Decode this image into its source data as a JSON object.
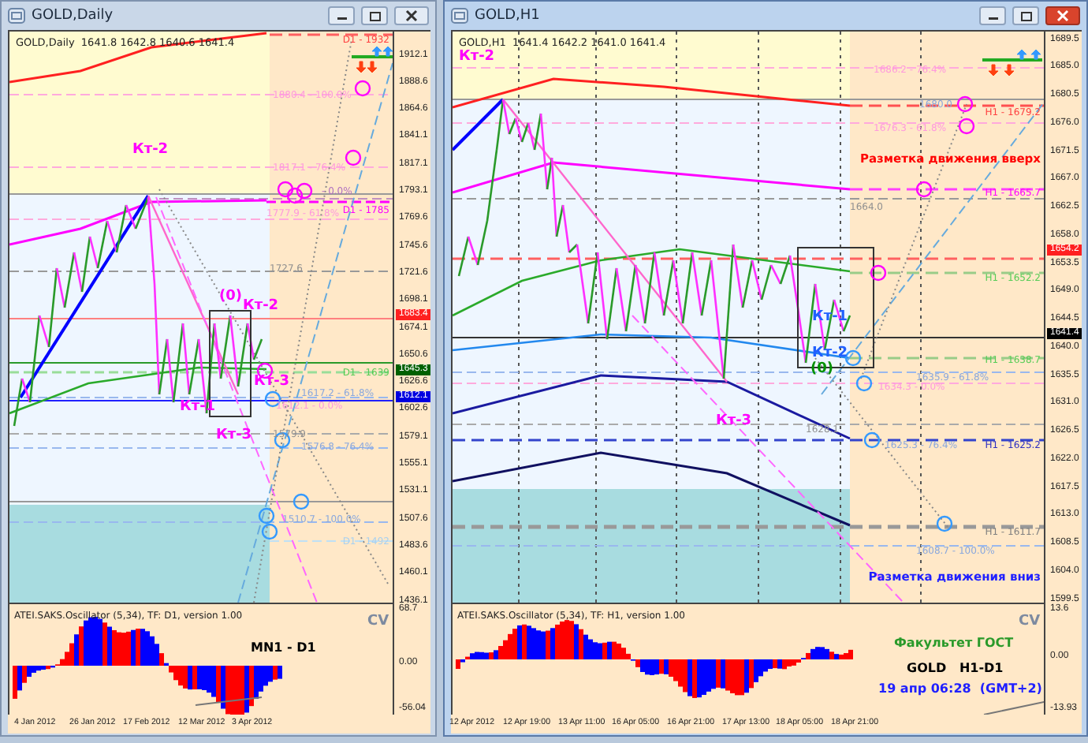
{
  "windows": [
    {
      "title": "GOLD,Daily",
      "active": false,
      "header": "GOLD,Daily  1641.8 1642.8 1640.6 1641.4",
      "labels": [
        {
          "text": "D1 - 1932",
          "kind": "level",
          "color": "#ff4040"
        },
        {
          "text": "1880.4 - 100.0%",
          "kind": "level",
          "color": "#ff99dd"
        },
        {
          "text": "Кт-2",
          "kind": "point",
          "color": "#ff00ff"
        },
        {
          "text": "1817.1 - 76.4%",
          "kind": "level",
          "color": "#ff99dd"
        },
        {
          "text": "- 0.0%",
          "kind": "level",
          "color": "#b070c0"
        },
        {
          "text": "D1 - 1785",
          "kind": "level",
          "color": "#ff00ff"
        },
        {
          "text": "1777.9 - 61.8%",
          "kind": "level",
          "color": "#ff99dd"
        },
        {
          "text": "1727.6",
          "kind": "level",
          "color": "#909090"
        },
        {
          "text": "(0)",
          "kind": "point",
          "color": "#ff00ff"
        },
        {
          "text": "Кт-2",
          "kind": "point",
          "color": "#ff00ff"
        },
        {
          "text": "D1 - 1639",
          "kind": "level",
          "color": "#55cc55"
        },
        {
          "text": "Кт-3",
          "kind": "point",
          "color": "#ff00ff"
        },
        {
          "text": "1617.2 - 61.8%",
          "kind": "level",
          "color": "#8aa8dd"
        },
        {
          "text": "Кт-1",
          "kind": "point",
          "color": "#ff00ff"
        },
        {
          "text": "1612.1 - 0.0%",
          "kind": "level",
          "color": "#ff99dd"
        },
        {
          "text": "Кт-3",
          "kind": "point",
          "color": "#ff00ff"
        },
        {
          "text": "1579.9",
          "kind": "level",
          "color": "#909090"
        },
        {
          "text": "1576.8 - 76.4%",
          "kind": "level",
          "color": "#8aa8dd"
        },
        {
          "text": "1510.7 - 100.0%",
          "kind": "level",
          "color": "#8aa8dd"
        },
        {
          "text": "D1 - 1492",
          "kind": "level",
          "color": "#a8d0f0"
        }
      ],
      "price_axis": [
        "1912.1",
        "1888.6",
        "1864.6",
        "1841.1",
        "1817.1",
        "1793.1",
        "1769.6",
        "1745.6",
        "1721.6",
        "1698.1",
        "1674.1",
        "1650.6",
        "1626.6",
        "1602.6",
        "1579.1",
        "1555.1",
        "1531.1",
        "1507.6",
        "1483.6",
        "1460.1",
        "1436.1"
      ],
      "price_markers": [
        {
          "text": "1683.4",
          "color": "#ff2020"
        },
        {
          "text": "1645.3",
          "color": "#006000"
        },
        {
          "text": "1612.1",
          "color": "#0000e0"
        }
      ],
      "oscillator": {
        "title": "ATEI.SAKS.Oscillator (5,34), TF: D1, version 1.00",
        "tag": "CV",
        "axis": [
          "68.7",
          "0.00",
          "-56.04"
        ],
        "notes": [
          {
            "text": "MN1 - D1",
            "color": "#000000"
          }
        ]
      },
      "time_axis": [
        "4 Jan 2012",
        "26 Jan 2012",
        "17 Feb 2012",
        "12 Mar 2012",
        "3 Apr 2012"
      ]
    },
    {
      "title": "GOLD,H1",
      "active": true,
      "header": "GOLD,H1  1641.4 1642.2 1641.0 1641.4",
      "labels": [
        {
          "text": "Кт-2",
          "kind": "point",
          "color": "#ff00ff"
        },
        {
          "text": "1686.2 - 76.4%",
          "kind": "level",
          "color": "#ff99dd"
        },
        {
          "text": "1680.0",
          "kind": "level",
          "color": "#8aa8dd"
        },
        {
          "text": "H1 - 1679.2",
          "kind": "level",
          "color": "#ff4040"
        },
        {
          "text": "1676.3 - 61.8%",
          "kind": "level",
          "color": "#ff99dd"
        },
        {
          "text": "Разметка движения вверх",
          "kind": "heading",
          "color": "#ff0000"
        },
        {
          "text": "H1 - 1665.7",
          "kind": "level",
          "color": "#ff00ff"
        },
        {
          "text": "1664.0",
          "kind": "level",
          "color": "#909090"
        },
        {
          "text": "H1 - 1652.2",
          "kind": "level",
          "color": "#55cc55"
        },
        {
          "text": "Кт-1",
          "kind": "point",
          "color": "#2060ff"
        },
        {
          "text": "Кт-2",
          "kind": "point",
          "color": "#2060ff"
        },
        {
          "text": "(0)",
          "kind": "point",
          "color": "#009000"
        },
        {
          "text": "H1 - 1638.7",
          "kind": "level",
          "color": "#55cc55"
        },
        {
          "text": "1635.9 - 61.8%",
          "kind": "level",
          "color": "#8aa8dd"
        },
        {
          "text": "1634.3 - 0.0%",
          "kind": "level",
          "color": "#ff99dd"
        },
        {
          "text": "Кт-3",
          "kind": "point",
          "color": "#ff00ff"
        },
        {
          "text": "1628.1",
          "kind": "level",
          "color": "#909090"
        },
        {
          "text": "1625.3 - 76.4%",
          "kind": "level",
          "color": "#8aa8dd"
        },
        {
          "text": "H1 - 1625.2",
          "kind": "level",
          "color": "#3030c0"
        },
        {
          "text": "H1 - 1611.7",
          "kind": "level",
          "color": "#808080"
        },
        {
          "text": "1608.7 - 100.0%",
          "kind": "level",
          "color": "#8aa8dd"
        },
        {
          "text": "Разметка движения вниз",
          "kind": "heading",
          "color": "#2020ff"
        }
      ],
      "price_axis": [
        "1689.5",
        "1685.0",
        "1680.5",
        "1676.0",
        "1671.5",
        "1667.0",
        "1662.5",
        "1658.0",
        "1653.5",
        "1649.0",
        "1644.5",
        "1640.0",
        "1635.5",
        "1631.0",
        "1626.5",
        "1622.0",
        "1617.5",
        "1613.0",
        "1608.5",
        "1604.0",
        "1599.5"
      ],
      "price_markers": [
        {
          "text": "1654.2",
          "color": "#ff2020"
        },
        {
          "text": "1641.4",
          "color": "#000000"
        }
      ],
      "oscillator": {
        "title": "ATEI.SAKS.Oscillator (5,34), TF: H1, version 1.00",
        "tag": "CV",
        "axis": [
          "13.6",
          "0.00",
          "-13.93"
        ],
        "notes": [
          {
            "text": "Факультет ГОСТ",
            "color": "#2a9a2a"
          },
          {
            "text": "GOLD   H1-D1",
            "color": "#000000"
          },
          {
            "text": "19 апр 06:28  (GMT+2)",
            "color": "#2020ff"
          }
        ]
      },
      "time_axis": [
        "12 Apr 2012",
        "12 Apr 19:00",
        "13 Apr 11:00",
        "16 Apr 05:00",
        "16 Apr 21:00",
        "17 Apr 13:00",
        "18 Apr 05:00",
        "18 Apr 21:00"
      ]
    }
  ]
}
